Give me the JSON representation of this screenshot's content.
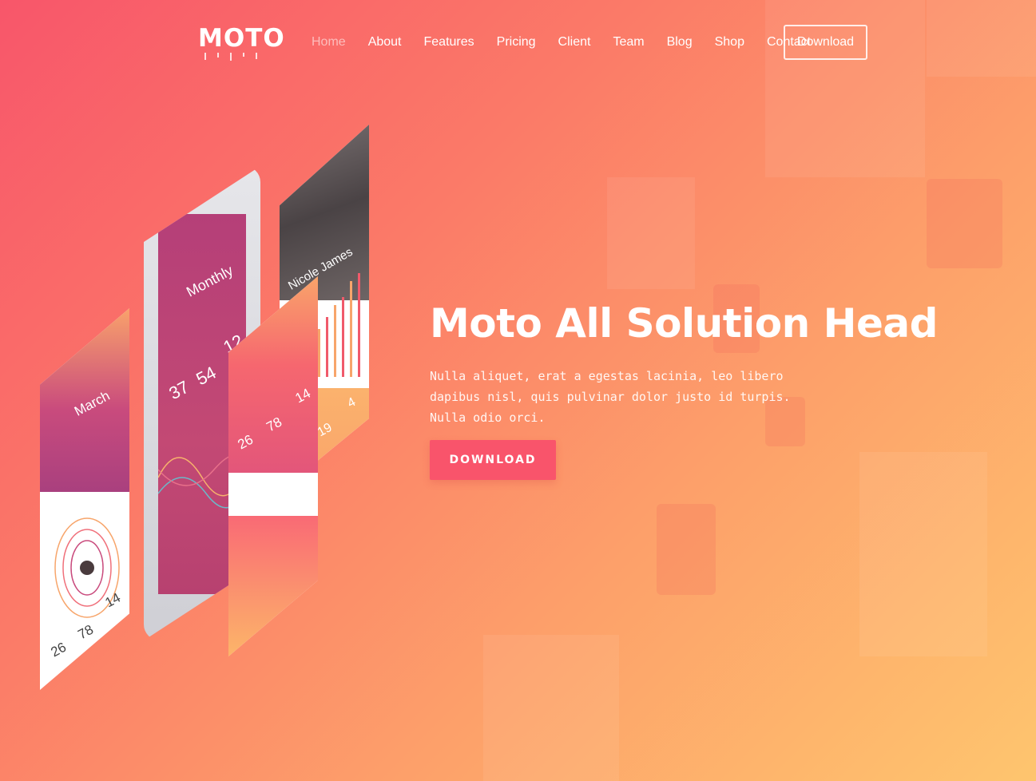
{
  "brand": {
    "logo": "MOTO"
  },
  "nav": {
    "items": [
      {
        "label": "Home",
        "active": true
      },
      {
        "label": "About"
      },
      {
        "label": "Features"
      },
      {
        "label": "Pricing"
      },
      {
        "label": "Client"
      },
      {
        "label": "Team"
      },
      {
        "label": "Blog"
      },
      {
        "label": "Shop"
      },
      {
        "label": "Contact"
      }
    ],
    "download_label": "Download"
  },
  "hero": {
    "title": "Moto All Solution Head",
    "text": "Nulla aliquet, erat a egestas lacinia, leo libero dapibus nisl, quis pulvinar dolor justo id turpis. Nulla odio orci.",
    "button_label": "DOWNLOAD"
  },
  "mockups": {
    "left_card": {
      "month": "March",
      "stats": [
        {
          "value": "26"
        },
        {
          "value": "78"
        },
        {
          "value": "14"
        }
      ]
    },
    "phone": {
      "title": "Monthly",
      "stats": [
        {
          "value": "37"
        },
        {
          "value": "54"
        },
        {
          "value": "12"
        }
      ]
    },
    "mid_card": {
      "stats": [
        {
          "value": "26"
        },
        {
          "value": "78"
        },
        {
          "value": "14"
        }
      ]
    },
    "right_card": {
      "name": "Nicole James",
      "stats": [
        {
          "value": "19"
        },
        {
          "value": "4"
        }
      ]
    }
  },
  "colors": {
    "accent": "#f9546b",
    "gradient_start": "#f8566a",
    "gradient_end": "#fec56e"
  }
}
